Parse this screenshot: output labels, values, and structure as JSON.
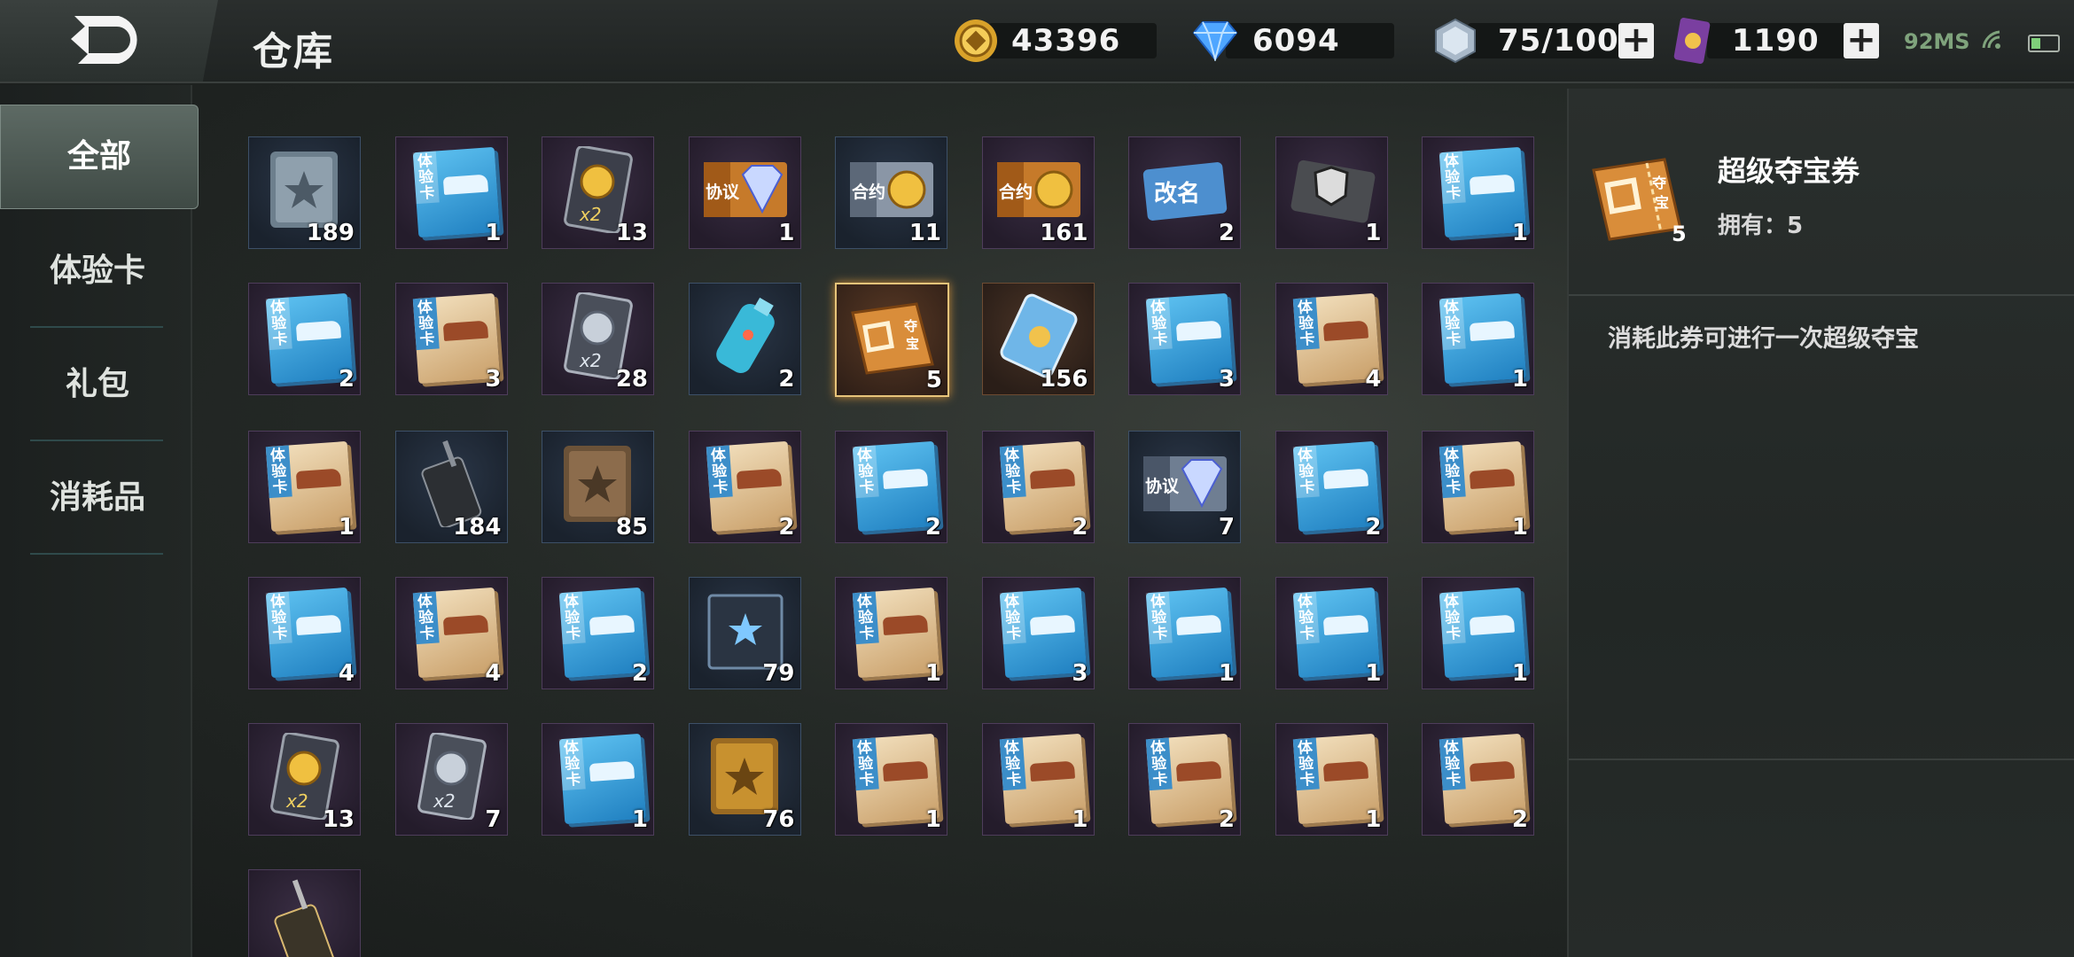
{
  "header": {
    "title": "仓库",
    "gold": "43396",
    "diamond": "6094",
    "energy": "75/100",
    "tickets": "1190",
    "ping": "92MS"
  },
  "sidebar": {
    "items": [
      {
        "label": "全部"
      },
      {
        "label": "体验卡"
      },
      {
        "label": "礼包"
      },
      {
        "label": "消耗品"
      }
    ]
  },
  "items": [
    {
      "kind": "book-blue",
      "count": "189"
    },
    {
      "kind": "card-blue",
      "count": "1"
    },
    {
      "kind": "gold-x2",
      "count": "13"
    },
    {
      "kind": "agreement-gold",
      "count": "1"
    },
    {
      "kind": "contract-blue",
      "count": "11"
    },
    {
      "kind": "contract-gold",
      "count": "161"
    },
    {
      "kind": "rename",
      "count": "2"
    },
    {
      "kind": "shield",
      "count": "1"
    },
    {
      "kind": "card-blue",
      "count": "1"
    },
    {
      "kind": "card-blue",
      "count": "2"
    },
    {
      "kind": "card-tan",
      "count": "3"
    },
    {
      "kind": "silver-x2",
      "count": "28"
    },
    {
      "kind": "canister",
      "count": "2"
    },
    {
      "kind": "treasure",
      "count": "5",
      "selected": true
    },
    {
      "kind": "ticket-blue",
      "count": "156"
    },
    {
      "kind": "card-blue",
      "count": "3"
    },
    {
      "kind": "card-tan",
      "count": "4"
    },
    {
      "kind": "card-blue",
      "count": "1"
    },
    {
      "kind": "card-tan",
      "count": "1"
    },
    {
      "kind": "radio",
      "count": "184"
    },
    {
      "kind": "book-brown",
      "count": "85"
    },
    {
      "kind": "card-tan",
      "count": "2"
    },
    {
      "kind": "card-blue",
      "count": "2"
    },
    {
      "kind": "card-tan",
      "count": "2"
    },
    {
      "kind": "agreement-blue",
      "count": "7"
    },
    {
      "kind": "card-blue",
      "count": "2"
    },
    {
      "kind": "card-tan",
      "count": "1"
    },
    {
      "kind": "card-blue",
      "count": "4"
    },
    {
      "kind": "card-tan",
      "count": "4"
    },
    {
      "kind": "card-blue",
      "count": "2"
    },
    {
      "kind": "crate",
      "count": "79"
    },
    {
      "kind": "card-tan",
      "count": "1"
    },
    {
      "kind": "card-blue",
      "count": "3"
    },
    {
      "kind": "card-blue",
      "count": "1"
    },
    {
      "kind": "card-blue",
      "count": "1"
    },
    {
      "kind": "card-blue",
      "count": "1"
    },
    {
      "kind": "gold-x2",
      "count": "13"
    },
    {
      "kind": "silver-x2",
      "count": "7"
    },
    {
      "kind": "card-blue",
      "count": "1"
    },
    {
      "kind": "book-gold",
      "count": "76"
    },
    {
      "kind": "card-tan",
      "count": "1"
    },
    {
      "kind": "card-tan",
      "count": "1"
    },
    {
      "kind": "card-tan",
      "count": "2"
    },
    {
      "kind": "card-tan",
      "count": "1"
    },
    {
      "kind": "card-tan",
      "count": "2"
    },
    {
      "kind": "radio-gold",
      "count": ""
    }
  ],
  "detail": {
    "name": "超级夺宝券",
    "owned": "拥有：5",
    "count": "5",
    "description": "消耗此券可进行一次超级夺宝"
  },
  "colors": {
    "accent_gold": "#e7c47a",
    "card_blue": "#2f8fd0",
    "card_tan": "#e3c89b",
    "slot_border": "#4e3d5b"
  }
}
